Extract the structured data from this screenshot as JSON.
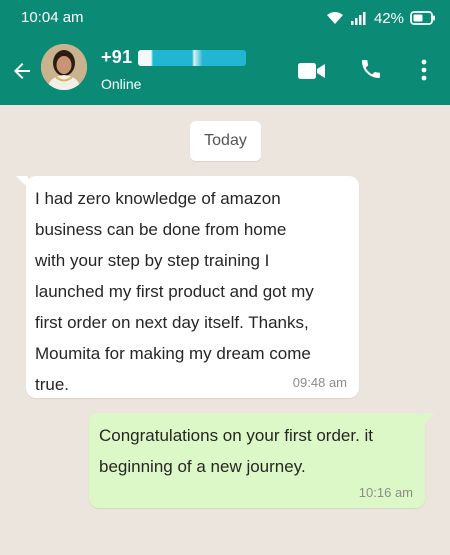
{
  "status_bar": {
    "time": "10:04 am",
    "battery_percent": "42%"
  },
  "chat_header": {
    "contact_prefix": "+91",
    "contact_status": "Online"
  },
  "date_divider": "Today",
  "messages": [
    {
      "direction": "incoming",
      "text": " I had zero knowledge of amazon\nbusiness can be done from home\nwith your step by step training I\nlaunched my first product and got my\nfirst order on next day itself. Thanks,\nMoumita for making my dream come\ntrue.",
      "time": "09:48 am"
    },
    {
      "direction": "outgoing",
      "text": " Congratulations on your first order. it\nbeginning of a new journey.",
      "time": "10:16 am"
    }
  ],
  "colors": {
    "header": "#0b8a76",
    "chat_background": "#ece5dd",
    "outgoing_bubble": "#dcf8c6",
    "incoming_bubble": "#ffffff"
  },
  "icons": [
    "back-arrow-icon",
    "video-call-icon",
    "phone-call-icon",
    "more-menu-icon",
    "wifi-icon",
    "signal-icon",
    "battery-icon"
  ]
}
